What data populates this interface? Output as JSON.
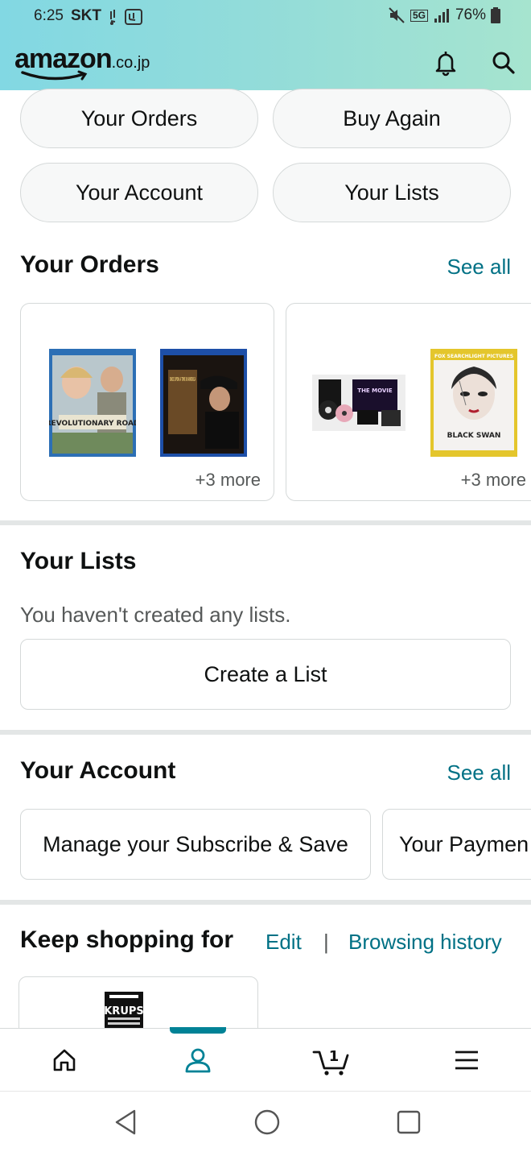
{
  "status_bar": {
    "time": "6:25",
    "carrier": "SKT",
    "network": "5G",
    "battery": "76%"
  },
  "header": {
    "logo_word": "amazon",
    "logo_tld": ".co.jp",
    "icons": [
      "bell-icon",
      "search-icon"
    ]
  },
  "quick_links": [
    "Your Orders",
    "Buy Again",
    "Your Account",
    "Your Lists"
  ],
  "orders": {
    "title": "Your Orders",
    "see_all": "See all",
    "cards": [
      {
        "more": "+3 more"
      },
      {
        "more": "+3 more"
      }
    ]
  },
  "lists": {
    "title": "Your Lists",
    "empty_text": "You haven't created any lists.",
    "create_label": "Create a List"
  },
  "account": {
    "title": "Your Account",
    "see_all": "See all",
    "cards": [
      "Manage your Subscribe & Save",
      "Your Paymen"
    ]
  },
  "keep_shopping": {
    "title": "Keep shopping for",
    "edit": "Edit",
    "separator": "|",
    "browsing_history": "Browsing history",
    "product_brand": "KRUPS"
  },
  "product_images": {
    "revolutionary_road": "REVOLUTIONARY ROAD",
    "once_upon": "ONCE UPON A TIME IN AMERICA",
    "the_movie": "THE MOVIE",
    "black_swan": "BLACK SWAN",
    "fox": "FOX SEARCHLIGHT PICTURES"
  },
  "bottom_nav": {
    "items": [
      "home-icon",
      "account-icon",
      "cart-icon",
      "menu-icon"
    ],
    "cart_count": "1",
    "active_index": 1
  },
  "colors": {
    "accent": "#008296",
    "link": "#007185",
    "header_start": "#82d8e3",
    "header_end": "#a6e4cf"
  }
}
